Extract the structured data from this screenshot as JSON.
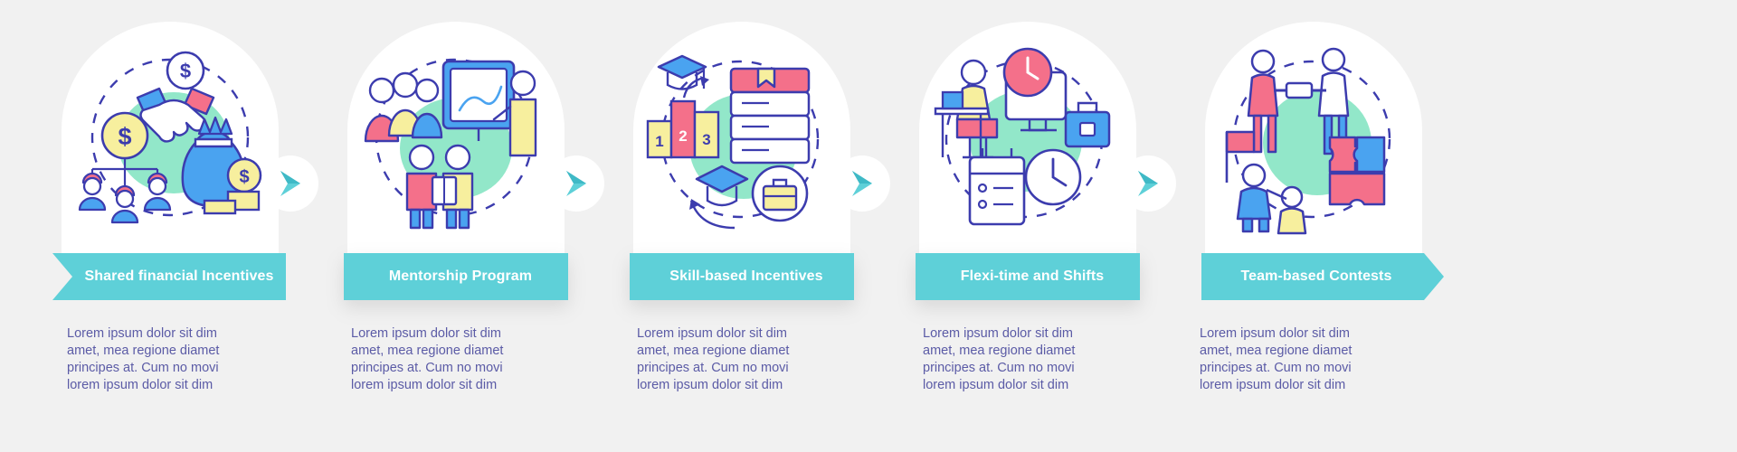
{
  "page": {
    "background_color": "#f1f1f1",
    "banner_color": "#5ed0d8",
    "text_color": "#5b5ba6",
    "accent_mint": "#7fe3c0",
    "accent_coral": "#f4708a",
    "accent_blue": "#4aa3f0",
    "accent_yellow": "#f7ef9e",
    "outline_color": "#4a4ab5"
  },
  "body_lines": [
    "Lorem ipsum dolor sit dim",
    "amet, mea regione diamet",
    "principes at. Cum no movi",
    "lorem ipsum dolor sit dim"
  ],
  "steps": [
    {
      "index": 1,
      "title_line1": "Shared financial",
      "title_line2": "Incentives",
      "icon_name": "handshake-money-icon",
      "banner_shape": "notch-left",
      "body": [
        "Lorem ipsum dolor sit dim",
        "amet, mea regione diamet",
        "principes at. Cum no movi",
        "lorem ipsum dolor sit dim"
      ]
    },
    {
      "index": 2,
      "title_line1": "Mentorship",
      "title_line2": "Program",
      "icon_name": "presentation-team-icon",
      "banner_shape": "plain",
      "body": [
        "Lorem ipsum dolor sit dim",
        "amet, mea regione diamet",
        "principes at. Cum no movi",
        "lorem ipsum dolor sit dim"
      ]
    },
    {
      "index": 3,
      "title_line1": "Skill-based",
      "title_line2": "Incentives",
      "icon_name": "graduation-books-icon",
      "banner_shape": "plain",
      "body": [
        "Lorem ipsum dolor sit dim",
        "amet, mea regione diamet",
        "principes at. Cum no movi",
        "lorem ipsum dolor sit dim"
      ]
    },
    {
      "index": 4,
      "title_line1": "Flexi-time and",
      "title_line2": "Shifts",
      "icon_name": "desk-clock-calendar-icon",
      "banner_shape": "plain",
      "body": [
        "Lorem ipsum dolor sit dim",
        "amet, mea regione diamet",
        "principes at. Cum no movi",
        "lorem ipsum dolor sit dim"
      ]
    },
    {
      "index": 5,
      "title_line1": "Team-based",
      "title_line2": "Contests",
      "icon_name": "teamwork-climbing-icon",
      "banner_shape": "point-right",
      "body": [
        "Lorem ipsum dolor sit dim",
        "amet, mea regione diamet",
        "principes at. Cum no movi",
        "lorem ipsum dolor sit dim"
      ]
    }
  ],
  "connectors": [
    {
      "index": 1,
      "icon_name": "chevron-right-icon"
    },
    {
      "index": 2,
      "icon_name": "chevron-right-icon"
    },
    {
      "index": 3,
      "icon_name": "chevron-right-icon"
    },
    {
      "index": 4,
      "icon_name": "chevron-right-icon"
    }
  ]
}
